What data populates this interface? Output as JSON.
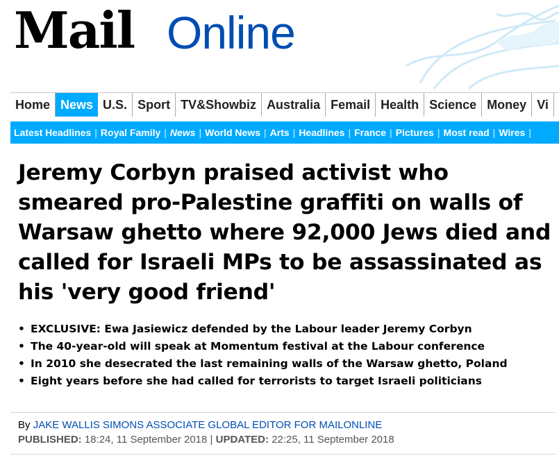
{
  "masthead": {
    "logo_mail": "Mail",
    "logo_online": "Online"
  },
  "nav_primary": [
    {
      "label": "Home",
      "active": false
    },
    {
      "label": "News",
      "active": true
    },
    {
      "label": "U.S.",
      "active": false
    },
    {
      "label": "Sport",
      "active": false
    },
    {
      "label": "TV&Showbiz",
      "active": false
    },
    {
      "label": "Australia",
      "active": false
    },
    {
      "label": "Femail",
      "active": false
    },
    {
      "label": "Health",
      "active": false
    },
    {
      "label": "Science",
      "active": false
    },
    {
      "label": "Money",
      "active": false
    },
    {
      "label": "Vi",
      "active": false
    }
  ],
  "nav_secondary": [
    "Latest Headlines",
    "Royal Family",
    "News",
    "World News",
    "Arts",
    "Headlines",
    "France",
    "Pictures",
    "Most read",
    "Wires"
  ],
  "article": {
    "headline": "Jeremy Corbyn praised activist who smeared pro-Palestine graffiti on walls of Warsaw ghetto where 92,000 Jews died and called for Israeli MPs to be assassinated as his 'very good friend'",
    "bullets": [
      "EXCLUSIVE: Ewa Jasiewicz defended by the Labour leader Jeremy Corbyn",
      "The 40-year-old will speak at Momentum festival at the Labour conference",
      "In 2010 she desecrated the last remaining walls of the Warsaw ghetto, Poland",
      "Eight years before she had called for terrorists to target Israeli politicians"
    ],
    "byline_prefix": "By",
    "author": "JAKE WALLIS SIMONS ASSOCIATE GLOBAL EDITOR FOR MAILONLINE",
    "published_label": "PUBLISHED:",
    "published_value": "18:24, 11 September 2018",
    "separator": "|",
    "updated_label": "UPDATED:",
    "updated_value": "22:25, 11 September 2018"
  },
  "colors": {
    "brand_blue": "#00aaff",
    "link_blue": "#004db3"
  }
}
